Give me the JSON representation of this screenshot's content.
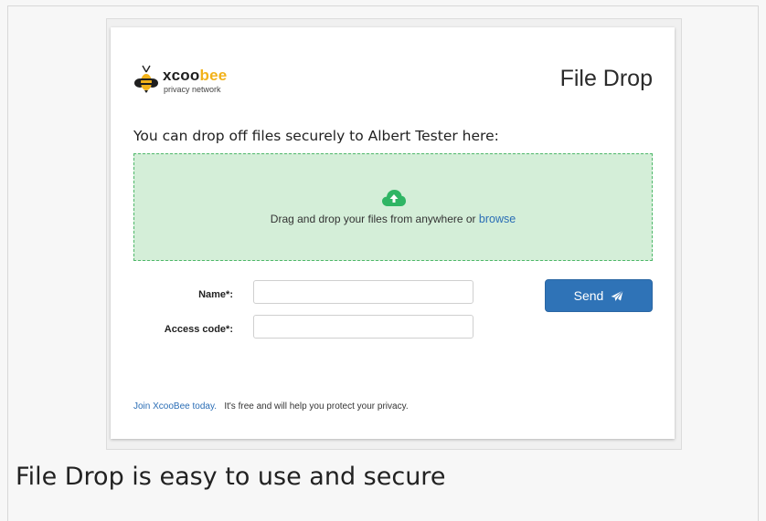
{
  "logo": {
    "word_dark": "xcoo",
    "word_accent": "bee",
    "tagline": "privacy network"
  },
  "header": {
    "title": "File Drop"
  },
  "intro": "You can drop off files securely to Albert Tester here:",
  "dropzone": {
    "text": "Drag and drop your files from anywhere or",
    "browse_link": "browse",
    "icon": "cloud-upload-icon"
  },
  "form": {
    "name_label": "Name*:",
    "name_value": "",
    "access_code_label": "Access code*:",
    "access_code_value": "",
    "send_label": "Send",
    "send_icon": "paper-plane-icon"
  },
  "footer": {
    "join_link": "Join XcooBee today.",
    "text": "It's free and will help you protect your privacy."
  },
  "caption": "File Drop is easy to use and secure",
  "colors": {
    "accent_blue": "#2f73b7",
    "dropzone_bg": "#d4eed8",
    "dropzone_border": "#4fb86a",
    "icon_green": "#2fb564",
    "logo_yellow": "#f2b21a"
  }
}
